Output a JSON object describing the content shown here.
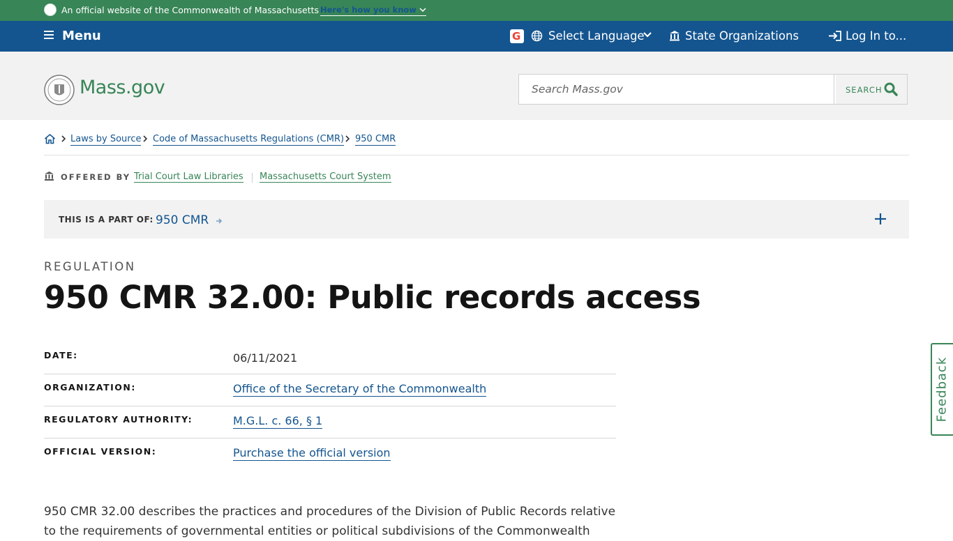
{
  "banner": {
    "official_text": "An official website of the Commonwealth of Massachusetts",
    "how_link": "Here's how you know"
  },
  "nav": {
    "menu_label": "Menu",
    "language_label": "Select Language",
    "state_orgs_label": "State Organizations",
    "login_label": "Log In to..."
  },
  "header": {
    "logo_text": "Mass.gov",
    "search_placeholder": "Search Mass.gov",
    "search_button_label": "SEARCH"
  },
  "breadcrumb": {
    "items": [
      "Laws by Source",
      "Code of Massachusetts Regulations (CMR)",
      "950 CMR"
    ]
  },
  "offered_by": {
    "label": "OFFERED BY",
    "orgs": [
      "Trial Court Law Libraries",
      "Massachusetts Court System"
    ]
  },
  "part_of": {
    "label": "THIS IS A PART OF:",
    "link": "950 CMR"
  },
  "page": {
    "category": "REGULATION",
    "title": "950 CMR 32.00: Public records access"
  },
  "meta": [
    {
      "key": "DATE:",
      "value": "06/11/2021"
    },
    {
      "key": "ORGANIZATION:",
      "value": "Office of the Secretary of the Commonwealth"
    },
    {
      "key": "REGULATORY AUTHORITY:",
      "value": "M.G.L. c. 66, § 1"
    },
    {
      "key": "OFFICIAL VERSION:",
      "value": "Purchase the official version"
    }
  ],
  "description": "950 CMR 32.00 describes the practices and procedures of the Division of Public Records relative to the requirements of governmental entities or political subdivisions of the Commonwealth",
  "feedback_label": "Feedback",
  "colors": {
    "green": "#388557",
    "blue": "#14558f",
    "gray_bg": "#f2f2f2"
  }
}
